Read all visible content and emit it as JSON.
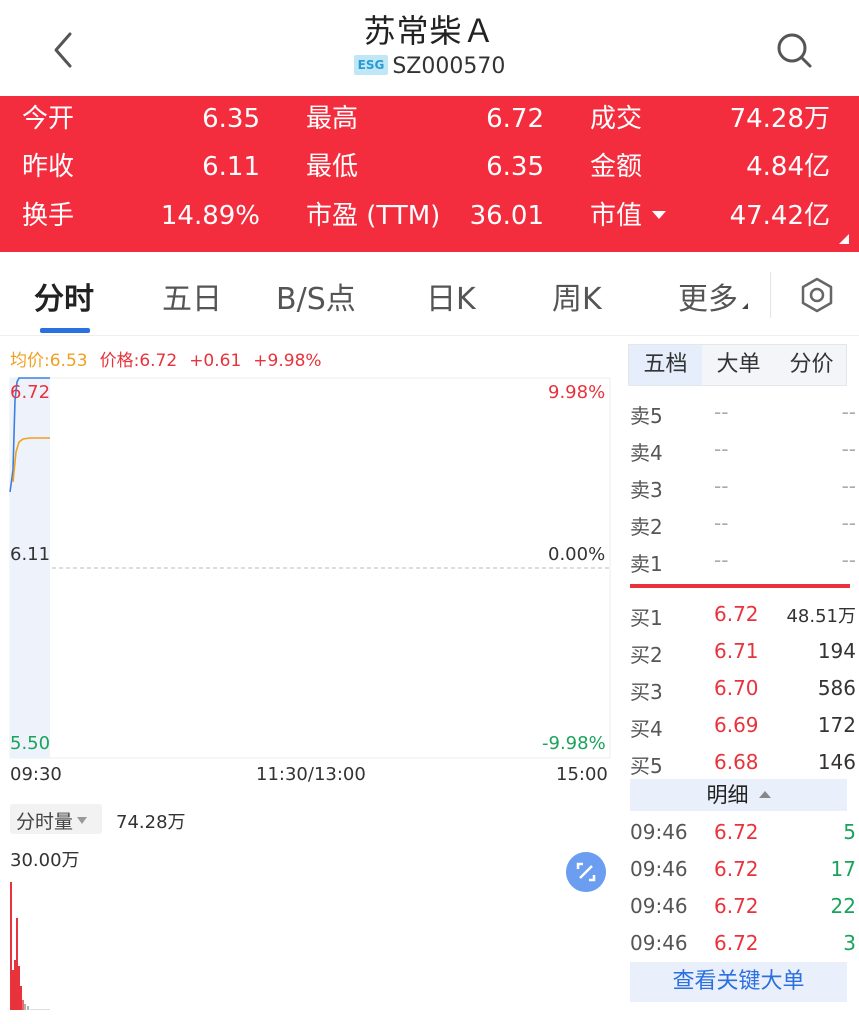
{
  "header": {
    "title": "苏常柴Ａ",
    "esg_badge": "ESG",
    "code": "SZ000570"
  },
  "quote": {
    "rows": [
      [
        {
          "label": "今开",
          "value": "6.35"
        },
        {
          "label": "最高",
          "value": "6.72"
        },
        {
          "label": "成交",
          "value": "74.28万"
        }
      ],
      [
        {
          "label": "昨收",
          "value": "6.11"
        },
        {
          "label": "最低",
          "value": "6.35"
        },
        {
          "label": "金额",
          "value": "4.84亿"
        }
      ],
      [
        {
          "label": "换手",
          "value": "14.89%"
        },
        {
          "label": "市盈 (TTM)",
          "value": "36.01"
        },
        {
          "label": "市值",
          "value": "47.42亿"
        }
      ]
    ],
    "bg_color": "#f42d3e"
  },
  "tabs": [
    {
      "label": "分时",
      "active": true
    },
    {
      "label": "五日"
    },
    {
      "label": "B/S点"
    },
    {
      "label": "日K"
    },
    {
      "label": "周K"
    },
    {
      "label": "更多"
    }
  ],
  "legend": {
    "avg": "均价:6.53",
    "price": "价格:6.72",
    "change": "+0.61",
    "pct": "+9.98%"
  },
  "price_axis": {
    "high": "6.72",
    "mid": "6.11",
    "low": "5.50",
    "high_pct": "9.98%",
    "mid_pct": "0.00%",
    "low_pct": "-9.98%"
  },
  "time_axis": {
    "start": "09:30",
    "mid": "11:30/13:00",
    "end": "15:00"
  },
  "volume": {
    "selector": "分时量",
    "total": "74.28万",
    "scale": "30.00万"
  },
  "right_panel": {
    "tabs": [
      "五档",
      "大单",
      "分价"
    ],
    "sell": [
      {
        "label": "卖5",
        "price": "--",
        "vol": "--"
      },
      {
        "label": "卖4",
        "price": "--",
        "vol": "--"
      },
      {
        "label": "卖3",
        "price": "--",
        "vol": "--"
      },
      {
        "label": "卖2",
        "price": "--",
        "vol": "--"
      },
      {
        "label": "卖1",
        "price": "--",
        "vol": "--"
      }
    ],
    "buy": [
      {
        "label": "买1",
        "price": "6.72",
        "vol": "48.51万"
      },
      {
        "label": "买2",
        "price": "6.71",
        "vol": "194"
      },
      {
        "label": "买3",
        "price": "6.70",
        "vol": "586"
      },
      {
        "label": "买4",
        "price": "6.69",
        "vol": "172"
      },
      {
        "label": "买5",
        "price": "6.68",
        "vol": "146"
      }
    ],
    "detail_label": "明细",
    "details": [
      {
        "time": "09:46",
        "price": "6.72",
        "vol": "5"
      },
      {
        "time": "09:46",
        "price": "6.72",
        "vol": "17"
      },
      {
        "time": "09:46",
        "price": "6.72",
        "vol": "22"
      },
      {
        "time": "09:46",
        "price": "6.72",
        "vol": "3"
      }
    ],
    "key_button": "查看关键大单"
  },
  "colors": {
    "up": "#e8333c",
    "down": "#1aa35c",
    "avg_line": "#f0a020",
    "price_line": "#3d7fe0",
    "accent": "#2c6fe0"
  }
}
